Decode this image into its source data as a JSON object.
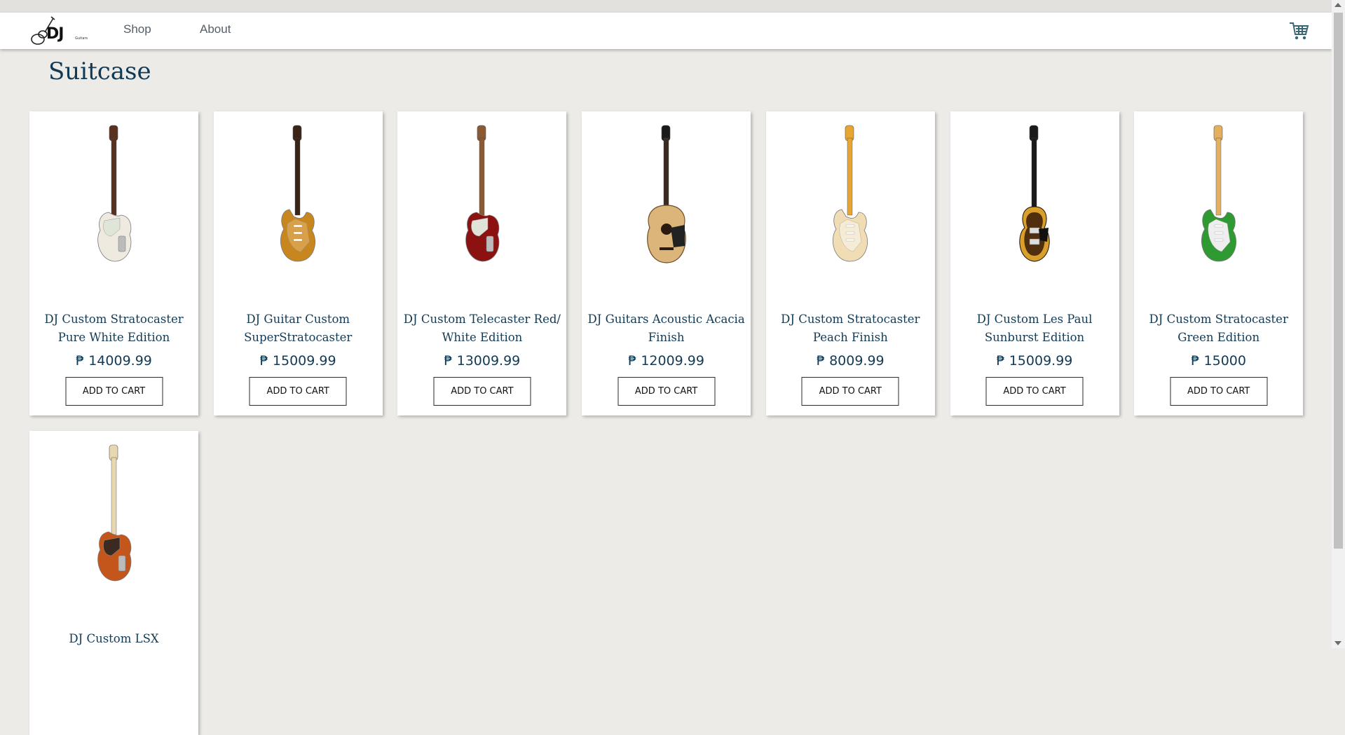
{
  "brand": {
    "logo_text": "DJ",
    "logo_subtext": "Guitars"
  },
  "nav": {
    "links": [
      "Shop",
      "About"
    ]
  },
  "page": {
    "title": "Suitcase"
  },
  "currency": "₱",
  "button_label": "ADD TO CART",
  "products": [
    {
      "name": "DJ Custom Stratocaster Pure White Edition",
      "price": "₱ 14009.99",
      "body_color": "#eeeae0",
      "neck_color": "#5a3020",
      "guard_color": "#dfe6d9",
      "style": "tele"
    },
    {
      "name": "DJ Guitar Custom SuperStratocaster",
      "price": "₱ 15009.99",
      "body_color": "#c8861e",
      "neck_color": "#3a2418",
      "guard_color": "#d9a04a",
      "style": "strat"
    },
    {
      "name": "DJ Custom Telecaster Red/ White Edition",
      "price": "₱ 13009.99",
      "body_color": "#8c1212",
      "neck_color": "#8a5a34",
      "guard_color": "#e0e4d8",
      "style": "tele"
    },
    {
      "name": "DJ Guitars Acoustic Acacia Finish",
      "price": "₱ 12009.99",
      "body_color": "#dcb57a",
      "neck_color": "#3a2a20",
      "guard_color": "#222222",
      "style": "acoustic"
    },
    {
      "name": "DJ Custom Stratocaster Peach Finish",
      "price": "₱ 8009.99",
      "body_color": "#f0ddb4",
      "neck_color": "#e8a630",
      "guard_color": "#f6ecd6",
      "style": "strat"
    },
    {
      "name": "DJ Custom Les Paul Sunburst Edition",
      "price": "₱ 15009.99",
      "body_color": "#3a1a08",
      "neck_color": "#1a1a1a",
      "guard_color": "#d8a02a",
      "style": "lespaul"
    },
    {
      "name": "DJ Custom Stratocaster Green Edition",
      "price": "₱ 15000",
      "body_color": "#2f9a32",
      "neck_color": "#e4b060",
      "guard_color": "#eeeeee",
      "style": "strat"
    },
    {
      "name": "DJ Custom LSX",
      "price": "",
      "body_color": "#c4561c",
      "neck_color": "#e8d8b0",
      "guard_color": "#3a2a20",
      "style": "tele"
    }
  ],
  "icons": {
    "cart": "shopping-cart-icon",
    "logo": "guitar-logo-icon"
  }
}
